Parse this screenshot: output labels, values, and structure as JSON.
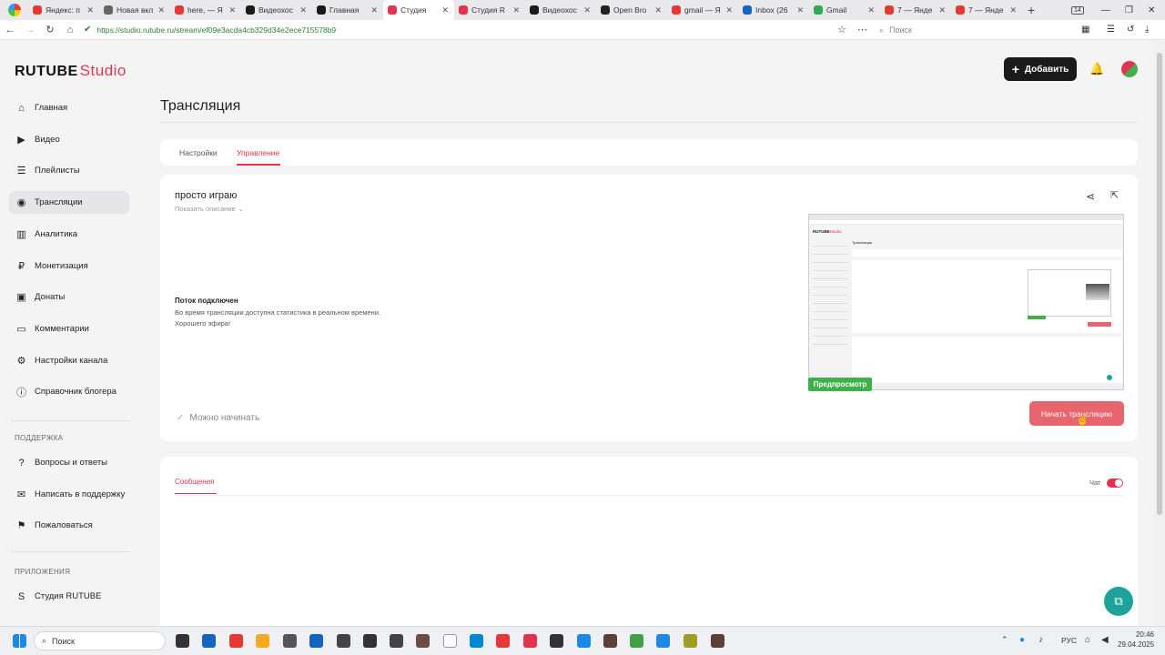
{
  "browser": {
    "tabs": [
      {
        "label": "Яндекс: п",
        "color": "#e53935"
      },
      {
        "label": "Новая вкл",
        "color": "#666666"
      },
      {
        "label": "here, — Я",
        "color": "#e53935"
      },
      {
        "label": "Видеохос",
        "color": "#1a1a1a"
      },
      {
        "label": "Главная",
        "color": "#1a1a1a"
      },
      {
        "label": "Студия",
        "color": "#e2344f",
        "active": true
      },
      {
        "label": "Студия R",
        "color": "#e2344f"
      },
      {
        "label": "Видеохос",
        "color": "#1a1a1a"
      },
      {
        "label": "Open Bro",
        "color": "#222222"
      },
      {
        "label": "gmail — Я",
        "color": "#e53935"
      },
      {
        "label": "Inbox (26",
        "color": "#1565c0"
      },
      {
        "label": "Gmail",
        "color": "#34a853"
      },
      {
        "label": "7 — Янде",
        "color": "#e53935"
      },
      {
        "label": "7 — Янде",
        "color": "#e53935"
      }
    ],
    "tab_count": "14",
    "url": "https://studio.rutube.ru/stream/ef09e3acda4cb329d34e2ece715578b9",
    "search_placeholder": "Поиск"
  },
  "header": {
    "logo_text": "RUTUBE",
    "logo_suffix": "Studio",
    "add_button": "Добавить"
  },
  "sidebar": {
    "items": [
      {
        "label": "Главная",
        "icon": "home-icon"
      },
      {
        "label": "Видео",
        "icon": "video-icon"
      },
      {
        "label": "Плейлисты",
        "icon": "playlist-icon"
      },
      {
        "label": "Трансляции",
        "icon": "broadcast-icon",
        "active": true
      },
      {
        "label": "Аналитика",
        "icon": "analytics-icon"
      },
      {
        "label": "Монетизация",
        "icon": "ruble-icon"
      },
      {
        "label": "Донаты",
        "icon": "donate-icon"
      },
      {
        "label": "Комментарии",
        "icon": "comment-icon"
      },
      {
        "label": "Настройки канала",
        "icon": "gear-icon"
      },
      {
        "label": "Справочник блогера",
        "icon": "info-icon"
      }
    ],
    "support_label": "ПОДДЕРЖКА",
    "support_items": [
      {
        "label": "Вопросы и ответы",
        "icon": "help-icon"
      },
      {
        "label": "Написать в поддержку",
        "icon": "mail-icon"
      },
      {
        "label": "Пожаловаться",
        "icon": "flag-icon"
      }
    ],
    "apps_label": "ПРИЛОЖЕНИЯ",
    "apps_items": [
      {
        "label": "Студия RUTUBE",
        "icon": "studio-app-icon"
      }
    ]
  },
  "main": {
    "title": "Трансляция",
    "tabs": [
      "Настройки",
      "Управление"
    ],
    "active_tab": "Управление",
    "stream": {
      "name": "просто играю",
      "show_description": "Показать описание",
      "status_title": "Поток подключен",
      "status_line1": "Во время трансляции доступна статистика в реальном времени.",
      "status_line2": "Хорошего эфира!",
      "preview_badge": "Предпросмотр",
      "ready_text": "Можно начинать",
      "start_button": "Начать трансляцию"
    },
    "chat": {
      "tab": "Сообщения",
      "toggle_label": "Чат",
      "enabled": true
    }
  },
  "taskbar": {
    "search_placeholder": "Поиск",
    "lang": "РУС",
    "time": "20:46",
    "date": "29.04.2025"
  },
  "colors": {
    "accent": "#e2344f",
    "button_dark": "#1a1a1a",
    "preview_green": "#3fb04a",
    "start_button": "#e8646f",
    "fab": "#1da39b"
  }
}
